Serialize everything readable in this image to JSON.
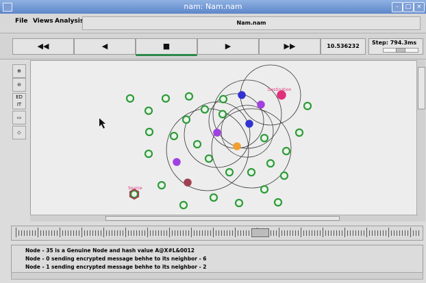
{
  "window": {
    "title": "nam: Nam.nam"
  },
  "menu": {
    "file": "File",
    "views": "Views",
    "analysis": "Analysis",
    "filename": "Nam.nam"
  },
  "controls": {
    "rewind": "◀◀",
    "back": "◀",
    "stop": "■",
    "play": "▶",
    "fast_forward": "▶▶",
    "time": "10.536232",
    "step": "Step: 794.3ms"
  },
  "tools": [
    "edit-icon"
  ],
  "nodes": {
    "labels": {
      "destination": "Destination",
      "source": "Source"
    },
    "colors": {
      "normal": "#2e9a3a",
      "blue": "#3232d0",
      "purple": "#a040e0",
      "orange": "#f0a030",
      "magenta": "#e0307a",
      "maroon": "#a04050"
    }
  },
  "log": [
    "Node - 35 is a Genuine Node and hash value A@X#L&0012",
    "Node - 0 sending encrypted message behhe to its neighbor - 6",
    "Node - 1 sending encrypted message behhe to its neighbor - 2"
  ]
}
